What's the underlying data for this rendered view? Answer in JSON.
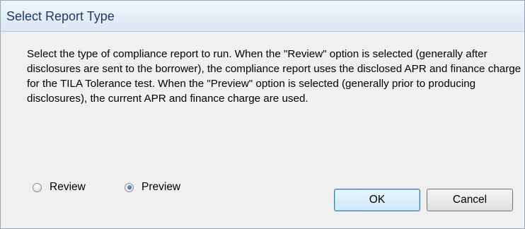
{
  "dialog": {
    "title": "Select Report Type",
    "description": "Select the type of compliance report to run.  When the \"Review\" option is selected (generally after disclosures are sent to the borrower), the compliance report uses the disclosed APR and finance charge for the TILA Tolerance test.  When the \"Preview\" option is selected (generally prior to producing disclosures), the current APR and finance charge are used.",
    "options": {
      "review_label": "Review",
      "preview_label": "Preview",
      "selected": "Preview"
    },
    "buttons": {
      "ok_label": "OK",
      "cancel_label": "Cancel"
    }
  }
}
